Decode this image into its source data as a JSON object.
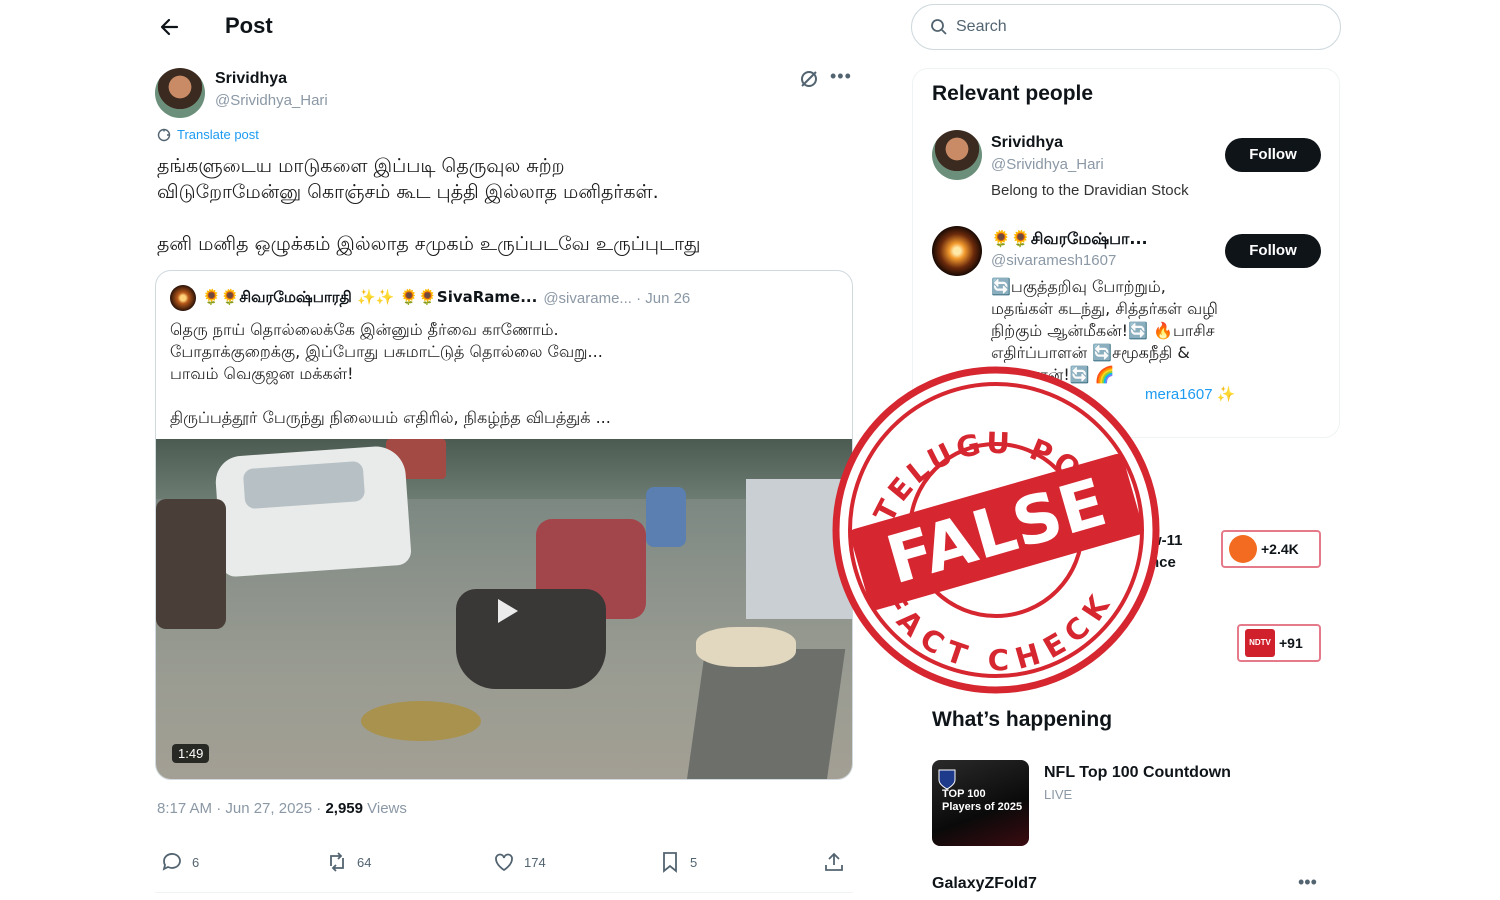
{
  "header": {
    "title": "Post"
  },
  "post": {
    "author_name": "Srividhya",
    "author_handle": "@Srividhya_Hari",
    "translate_label": "Translate post",
    "text": "தங்களுடைய மாடுகளை இப்படி தெருவுல சுற்ற\nவிடுறோமேன்னு கொஞ்சம் கூட புத்தி இல்லாத மனிதர்கள்.\n\nதனி மனித ஒழுக்கம் இல்லாத சமுகம் உருப்படவே உருப்புடாது",
    "timestamp": "8:17 AM · Jun 27, 2025 · ",
    "views_count": "2,959",
    "views_label": " Views",
    "actions": {
      "replies": "6",
      "reposts": "64",
      "likes": "174",
      "bookmarks": "5"
    }
  },
  "quote": {
    "name": "🌻🌻சிவரமேஷ்பாரதி ✨✨ 🌻🌻SivaRame...",
    "handle_date": "@sivarame... · Jun 26",
    "text": "தெரு நாய் தொல்லைக்கே இன்னும் தீர்வை காணோம்.\nபோதாக்குறைக்கு, இப்போது பசுமாட்டுத் தொல்லை வேறு...\n  பாவம் வெகுஜன மக்கள்!\n\nதிருப்பத்தூர் பேருந்து நிலையம் எதிரில், நிகழ்ந்த விபத்துக் ...",
    "video_duration": "1:49"
  },
  "sidebar": {
    "search_placeholder": "Search",
    "relevant_title": "Relevant people",
    "people": [
      {
        "name": "Srividhya",
        "handle": "@Srividhya_Hari",
        "bio": "Belong to the Dravidian Stock",
        "follow_label": "Follow"
      },
      {
        "name": "🌻🌻சிவரமேஷ்பா...",
        "handle": "@sivaramesh1607",
        "follow_label": "Follow",
        "bio": "🔄பகுத்தறிவு போற்றும்,\nமதங்கள் கடந்து, சித்தர்கள் வழி\nநிற்கும் ஆன்மீகன்!🔄 🔥பாசிச\nஎதிர்ப்பாளன் 🔄சமூகநீதி &\n                             தரவாளன்!🔄 🌈",
        "bio_tail": "mera1607 ✨"
      }
    ],
    "trends": [
      {
        "text": "w-11\nnce",
        "badge_count": "+2.4K",
        "badge_color": "#f26b21"
      },
      {
        "badge_count": "+91",
        "badge_color": "#d0202b",
        "badge_logo": "NDTV"
      }
    ],
    "whats_happening_title": "What’s happening",
    "nfl": {
      "title": "NFL Top 100 Countdown",
      "status": "LIVE",
      "thumb_text": "TOP 100\nPlayers of 2025"
    },
    "trend3": {
      "title": "GalaxyZFold7"
    }
  },
  "stamp": {
    "top_text": "TELUGU POST",
    "verdict": "FALSE",
    "bottom_text": "FACT CHECK",
    "color": "#d62630"
  }
}
